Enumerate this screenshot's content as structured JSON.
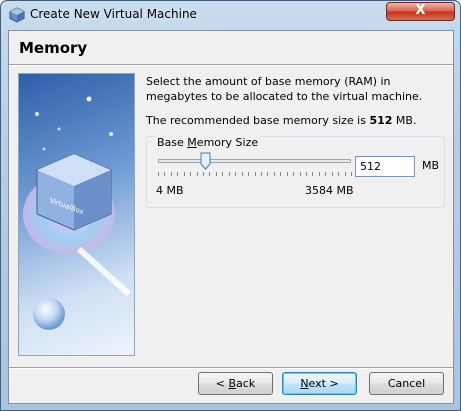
{
  "window": {
    "title": "Create New Virtual Machine",
    "close_glyph": "X",
    "help_glyph": "?"
  },
  "page": {
    "heading": "Memory",
    "description": "Select the amount of base memory (RAM) in megabytes to be allocated to the virtual machine.",
    "recommended_prefix": "The recommended base memory size is ",
    "recommended_value": "512",
    "recommended_suffix": " MB."
  },
  "memory": {
    "group_label_pre": "Base ",
    "group_label_accel": "M",
    "group_label_post": "emory Size",
    "value": "512",
    "unit": "MB",
    "min_label": "4 MB",
    "max_label": "3584 MB",
    "min": 4,
    "max": 3584,
    "current": 512
  },
  "buttons": {
    "back_prefix": "< ",
    "back_accel": "B",
    "back_rest": "ack",
    "next_accel": "N",
    "next_rest": "ext >",
    "cancel": "Cancel"
  },
  "icons": {
    "title": "virtualbox-logo-icon",
    "illustration": "virtualbox-cube-disc-illustration"
  },
  "colors": {
    "title_bar": "#b8cfe6",
    "close_button": "#c3341f",
    "dialog_bg": "#f0f0f0",
    "default_button": "#3c7fb1"
  }
}
